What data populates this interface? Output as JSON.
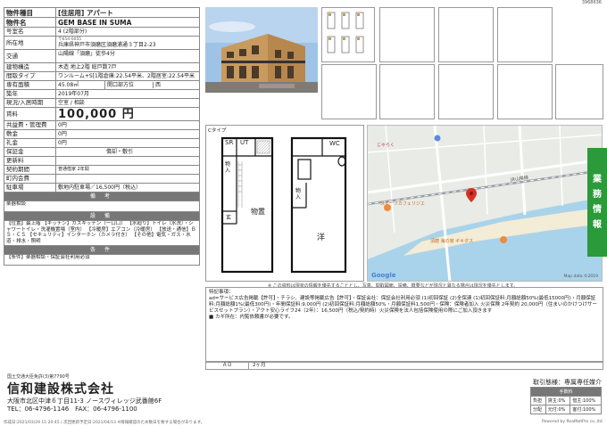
{
  "doc_id": "3968636",
  "spec": {
    "rows": [
      {
        "k": "物件種目",
        "v": "[住居用] アパート"
      },
      {
        "k": "物件名",
        "v": "GEM BASE IN SUMA"
      },
      {
        "k": "号室名",
        "v": "4 (2階部分)"
      }
    ],
    "address_key": "所在地",
    "postal": "〒654-0055",
    "address": "兵庫県神戸市須磨区須磨浦通３丁目2-23",
    "transport_key": "交通",
    "transport": "山陽線「須磨」徒歩4分",
    "structure_key": "建物構造",
    "structure": "木造 地上2階 総戸数7戸",
    "layout_key": "間取タイプ",
    "layout": "ワンルーム+S[1階倉庫:22.54平米、2階居室:22.54平米",
    "area_key": "専有面積",
    "area": "45.08㎡",
    "direction_key": "開口部方位",
    "direction": "西",
    "built_key": "築年",
    "built": "2019年07月",
    "status_key": "現況/入居時期",
    "status": "空室 / 相談",
    "rent_key": "賃料",
    "rent": "100,000 円",
    "fees": [
      {
        "k": "共益費・管理費",
        "v": "0円"
      },
      {
        "k": "敷金",
        "v": "0円"
      },
      {
        "k": "礼金",
        "v": "0円"
      }
    ],
    "deposit_key": "保証金",
    "shikibiki": "償却・敷引",
    "renewal_key": "更新料",
    "contract_key": "契約期間",
    "contract": "普通借家 2年間",
    "neighborhood_key": "町内会費",
    "parking_key": "駐車場",
    "parking": "敷地内駐車場／16,500円（税込）"
  },
  "sections": {
    "remarks_label": "備 考",
    "remarks": "楽器相談",
    "equipment_label": "設 備",
    "equipment": "【位置】最上階 【キッチン】ガスキッチン（一口口） 【水廻り】トイレ（水洗）・シャワートイレ・洗濯機置場（室内） 【冷暖房】エアコン（冷暖房） 【放送・通信】ＢＳ・ＣＳ 【セキュリティ】インターホン（カメラ付き） 【その他】電気・ガス・水道・排水・照明",
    "conditions_label": "条 件",
    "conditions": "【条件】楽器相談・保証会社利用必須"
  },
  "floorplan": {
    "title": "Cタイプ",
    "rooms": [
      "SR",
      "UT",
      "物入",
      "玄",
      "物置",
      "WC",
      "物入",
      "洋"
    ]
  },
  "map": {
    "labels": [
      "じゃらく",
      "JR山陽線",
      "スイーツカフェリジエ",
      "須磨 海の家 ギキダス"
    ],
    "copyright": "Map data ©2019",
    "google": "Google"
  },
  "map_note": "※ この資料は現状の情報を優先することとし、写真、間取図面、設備、概要などが現況と異なる場合は現況を優先とします。",
  "remarks_box": {
    "title": "特記事項：",
    "text": "ad=サービス広告掲載【許可】・チラシ、建設等掲載広告【許可】・保証会社：保証会社利用必須 (1)初回保証 (2)全保連 (1)初回保証料:月額総額50%(最低15000円)・月額保証料:月額総額1%(最低300円)・年間保証料:9,000円 (2)初回保証料:月額総額50%・月額保証料1,500円・保険：保険者加入 火災保険 2年契約 20,000円（住まいのかけつけサービスセットプラン）・アクト安心ライフ24（2年）：16,500円（税込/契約時）火災保険を法人包括保険使用の際にご加入頂きます",
    "note": "■ カギ所在：内覧依頼書が必要です。"
  },
  "ad_label": "ＡＤ",
  "ad_value": "2ヶ月",
  "side_tab": [
    "業",
    "務",
    "情",
    "報"
  ],
  "company": {
    "license": "国土交通大臣免許(3)第7790号",
    "name": "信和建設株式会社",
    "address": "大阪市北区中津６丁目11-3 ノースヴィレッジ武番館6F",
    "tel": "TEL：06-4796-1146　FAX：06-4796-1100"
  },
  "trade": {
    "title": "取引態様：専属専任媒介",
    "fee_header": "手数料",
    "rows": [
      {
        "k": "負担",
        "a": "貸主:0%",
        "b": "借主:100%"
      },
      {
        "k": "分配",
        "a": "元付:0%",
        "b": "客付:100%"
      }
    ]
  },
  "footer": {
    "left": "作成日:2021/03/29 11:20:45 / 次回更新予定日:2021/04/13 ※情報確認のため数日を要する場合があります。",
    "right": "Powered by RealNetPro co.,ltd."
  }
}
